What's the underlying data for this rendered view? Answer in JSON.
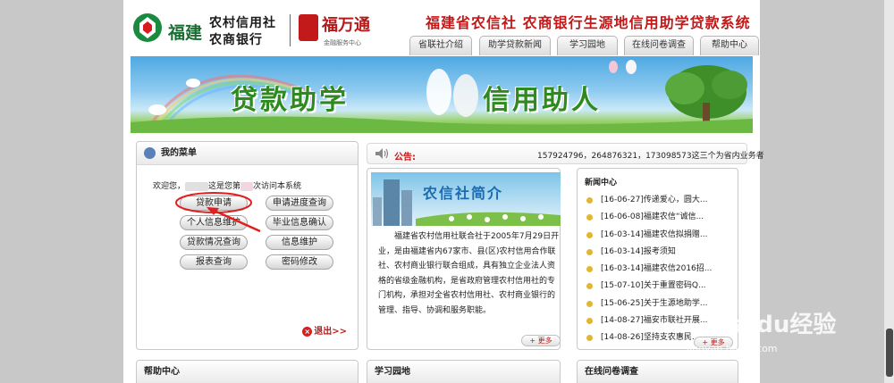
{
  "header": {
    "logo_province": "福建",
    "bank_line1": "农村信用社",
    "bank_line2": "农商银行",
    "brand_name": "福万通",
    "brand_sub": "金融服务中心",
    "system_title": "福建省农信社 农商银行生源地信用助学贷款系统"
  },
  "nav": {
    "tabs": [
      {
        "label": "省联社介绍"
      },
      {
        "label": "助学贷款新闻"
      },
      {
        "label": "学习园地"
      },
      {
        "label": "在线问卷调查"
      },
      {
        "label": "帮助中心"
      }
    ]
  },
  "banner": {
    "left_text": "贷款助学",
    "right_text": "信用助人"
  },
  "menu": {
    "title": "我的菜单",
    "welcome_prefix": "欢迎您，",
    "welcome_mid": "这是您第",
    "welcome_suffix": "次访问本系统",
    "buttons": [
      {
        "label": "贷款申请"
      },
      {
        "label": "申请进度查询"
      },
      {
        "label": "个人信息维护"
      },
      {
        "label": "毕业信息确认"
      },
      {
        "label": "贷款情况查询"
      },
      {
        "label": "信息维护"
      },
      {
        "label": "报表查询"
      },
      {
        "label": "密码修改"
      }
    ],
    "exit_label": "退出>>"
  },
  "notice": {
    "label": "公告:",
    "text": "157924796，264876321，173098573这三个为省内业务者"
  },
  "intro": {
    "banner_title": "农信社简介",
    "text": "福建省农村信用社联合社于2005年7月29日开业，是由福建省内67家市、县(区)农村信用合作联社、农村商业银行联合组成，具有独立企业法人资格的省级金融机构，是省政府管理农村信用社的专门机构，承担对全省农村信用社、农村商业银行的管理、指导、协调和服务职能。",
    "more_label": "+ 更多"
  },
  "news": {
    "title": "新闻中心",
    "items": [
      {
        "date": "[16-06-27]",
        "title": "传递爱心，圆大..."
      },
      {
        "date": "[16-06-08]",
        "title": "福建农信“诚信..."
      },
      {
        "date": "[16-03-14]",
        "title": "福建农信拟捐赠..."
      },
      {
        "date": "[16-03-14]",
        "title": "报考须知"
      },
      {
        "date": "[16-03-14]",
        "title": "福建农信2016招..."
      },
      {
        "date": "[15-07-10]",
        "title": "关于重置密码Q..."
      },
      {
        "date": "[15-06-25]",
        "title": "关于生源地助学..."
      },
      {
        "date": "[14-08-27]",
        "title": "福安市联社开展..."
      },
      {
        "date": "[14-08-26]",
        "title": "坚持支农惠民..."
      }
    ],
    "more_label": "+ 更多"
  },
  "bottom": {
    "help_title": "帮助中心",
    "study_title": "学习园地",
    "survey_title": "在线问卷调查"
  },
  "watermark": {
    "brand": "Baidu经验",
    "url": "jingyan.baidu.com"
  },
  "colors": {
    "accent_red": "#c41818",
    "banner_green": "#2e8a1e",
    "news_dot": "#e2b632"
  }
}
